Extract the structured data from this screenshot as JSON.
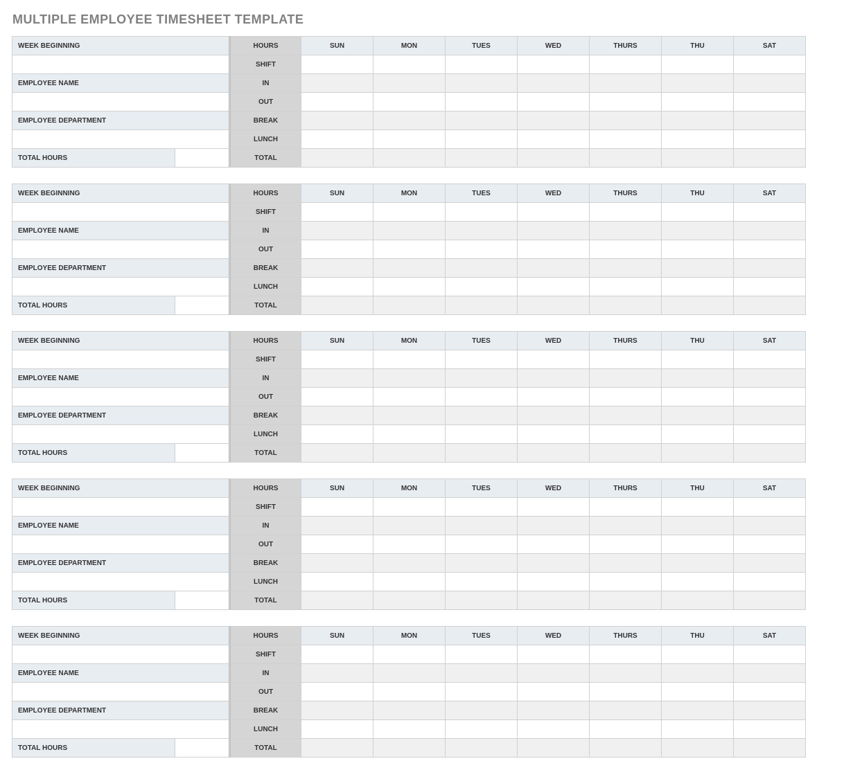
{
  "title": "MULTIPLE EMPLOYEE TIMESHEET TEMPLATE",
  "labels": {
    "week_beginning": "WEEK BEGINNING",
    "employee_name": "EMPLOYEE NAME",
    "employee_department": "EMPLOYEE DEPARTMENT",
    "total_hours": "TOTAL HOURS",
    "hours": "HOURS"
  },
  "row_labels": [
    "SHIFT",
    "IN",
    "OUT",
    "BREAK",
    "LUNCH",
    "TOTAL"
  ],
  "days": [
    "SUN",
    "MON",
    "TUES",
    "WED",
    "THURS",
    "THU",
    "SAT"
  ],
  "timesheets": [
    {
      "week_beginning": "",
      "employee_name": "",
      "employee_department": "",
      "total_hours": "",
      "grid": {
        "SHIFT": [
          "",
          "",
          "",
          "",
          "",
          "",
          ""
        ],
        "IN": [
          "",
          "",
          "",
          "",
          "",
          "",
          ""
        ],
        "OUT": [
          "",
          "",
          "",
          "",
          "",
          "",
          ""
        ],
        "BREAK": [
          "",
          "",
          "",
          "",
          "",
          "",
          ""
        ],
        "LUNCH": [
          "",
          "",
          "",
          "",
          "",
          "",
          ""
        ],
        "TOTAL": [
          "",
          "",
          "",
          "",
          "",
          "",
          ""
        ]
      }
    },
    {
      "week_beginning": "",
      "employee_name": "",
      "employee_department": "",
      "total_hours": "",
      "grid": {
        "SHIFT": [
          "",
          "",
          "",
          "",
          "",
          "",
          ""
        ],
        "IN": [
          "",
          "",
          "",
          "",
          "",
          "",
          ""
        ],
        "OUT": [
          "",
          "",
          "",
          "",
          "",
          "",
          ""
        ],
        "BREAK": [
          "",
          "",
          "",
          "",
          "",
          "",
          ""
        ],
        "LUNCH": [
          "",
          "",
          "",
          "",
          "",
          "",
          ""
        ],
        "TOTAL": [
          "",
          "",
          "",
          "",
          "",
          "",
          ""
        ]
      }
    },
    {
      "week_beginning": "",
      "employee_name": "",
      "employee_department": "",
      "total_hours": "",
      "grid": {
        "SHIFT": [
          "",
          "",
          "",
          "",
          "",
          "",
          ""
        ],
        "IN": [
          "",
          "",
          "",
          "",
          "",
          "",
          ""
        ],
        "OUT": [
          "",
          "",
          "",
          "",
          "",
          "",
          ""
        ],
        "BREAK": [
          "",
          "",
          "",
          "",
          "",
          "",
          ""
        ],
        "LUNCH": [
          "",
          "",
          "",
          "",
          "",
          "",
          ""
        ],
        "TOTAL": [
          "",
          "",
          "",
          "",
          "",
          "",
          ""
        ]
      }
    },
    {
      "week_beginning": "",
      "employee_name": "",
      "employee_department": "",
      "total_hours": "",
      "grid": {
        "SHIFT": [
          "",
          "",
          "",
          "",
          "",
          "",
          ""
        ],
        "IN": [
          "",
          "",
          "",
          "",
          "",
          "",
          ""
        ],
        "OUT": [
          "",
          "",
          "",
          "",
          "",
          "",
          ""
        ],
        "BREAK": [
          "",
          "",
          "",
          "",
          "",
          "",
          ""
        ],
        "LUNCH": [
          "",
          "",
          "",
          "",
          "",
          "",
          ""
        ],
        "TOTAL": [
          "",
          "",
          "",
          "",
          "",
          "",
          ""
        ]
      }
    },
    {
      "week_beginning": "",
      "employee_name": "",
      "employee_department": "",
      "total_hours": "",
      "grid": {
        "SHIFT": [
          "",
          "",
          "",
          "",
          "",
          "",
          ""
        ],
        "IN": [
          "",
          "",
          "",
          "",
          "",
          "",
          ""
        ],
        "OUT": [
          "",
          "",
          "",
          "",
          "",
          "",
          ""
        ],
        "BREAK": [
          "",
          "",
          "",
          "",
          "",
          "",
          ""
        ],
        "LUNCH": [
          "",
          "",
          "",
          "",
          "",
          "",
          ""
        ],
        "TOTAL": [
          "",
          "",
          "",
          "",
          "",
          "",
          ""
        ]
      }
    }
  ]
}
